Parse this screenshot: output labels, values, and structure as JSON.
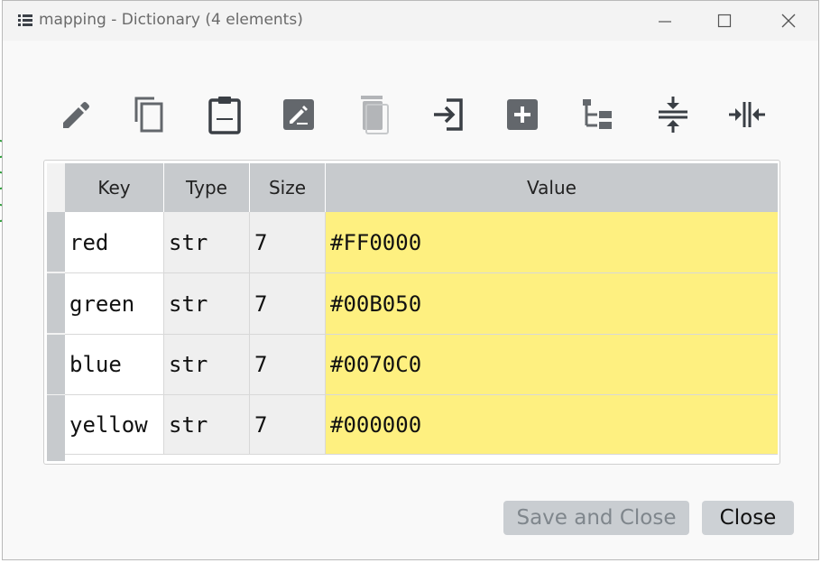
{
  "window": {
    "title": "mapping - Dictionary (4 elements)"
  },
  "toolbar": {
    "items": [
      {
        "icon": "edit-pencil-icon"
      },
      {
        "icon": "copy-icon"
      },
      {
        "icon": "paste-icon"
      },
      {
        "icon": "rename-icon"
      },
      {
        "icon": "delete-icon"
      },
      {
        "icon": "insert-icon"
      },
      {
        "icon": "add-icon"
      },
      {
        "icon": "tree-view-icon"
      },
      {
        "icon": "collapse-vertical-icon"
      },
      {
        "icon": "collapse-horizontal-icon"
      }
    ]
  },
  "table": {
    "columns": [
      "Key",
      "Type",
      "Size",
      "Value"
    ],
    "rows": [
      {
        "key": "red",
        "type": "str",
        "size": "7",
        "value": "#FF0000"
      },
      {
        "key": "green",
        "type": "str",
        "size": "7",
        "value": "#00B050"
      },
      {
        "key": "blue",
        "type": "str",
        "size": "7",
        "value": "#0070C0"
      },
      {
        "key": "yellow",
        "type": "str",
        "size": "7",
        "value": "#000000"
      }
    ]
  },
  "buttons": {
    "save_and_close": "Save and Close",
    "close": "Close"
  },
  "colors": {
    "value_cell": "#fef080",
    "header": "#c7cacd",
    "icon_dark": "#3a3f45",
    "icon_gray": "#5e6267"
  }
}
